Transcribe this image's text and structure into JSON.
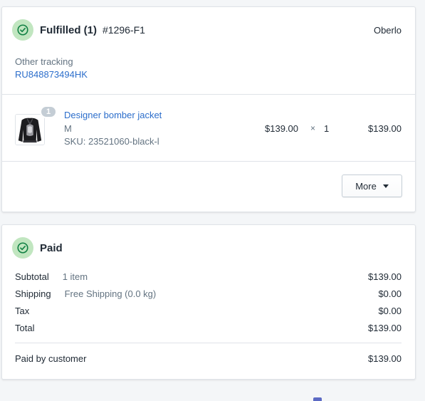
{
  "fulfillment": {
    "title": "Fulfilled (1)",
    "order_number": "#1296-F1",
    "provider": "Oberlo",
    "tracking_label": "Other tracking",
    "tracking_number": "RU848873494HK",
    "item": {
      "quantity_badge": "1",
      "name": "Designer bomber jacket",
      "variant": "M",
      "sku": "SKU: 23521060-black-l",
      "price": "$139.00",
      "times": "×",
      "quantity": "1",
      "total": "$139.00"
    },
    "more_label": "More"
  },
  "payment": {
    "title": "Paid",
    "rows": [
      {
        "label": "Subtotal",
        "detail": "1 item",
        "amount": "$139.00"
      },
      {
        "label": "Shipping",
        "detail": "Free Shipping (0.0 kg)",
        "amount": "$0.00"
      },
      {
        "label": "Tax",
        "detail": "",
        "amount": "$0.00"
      },
      {
        "label": "Total",
        "detail": "",
        "amount": "$139.00"
      }
    ],
    "paid_by_label": "Paid by customer",
    "paid_by_amount": "$139.00"
  },
  "icons": {
    "status": "check-circle-icon",
    "more": "caret-down-icon",
    "product": "jacket-thumbnail"
  },
  "colors": {
    "link": "#2c6ecb",
    "success_ring": "#c1e6c0",
    "success_icon": "#108043",
    "badge": "#c4cdd5"
  }
}
